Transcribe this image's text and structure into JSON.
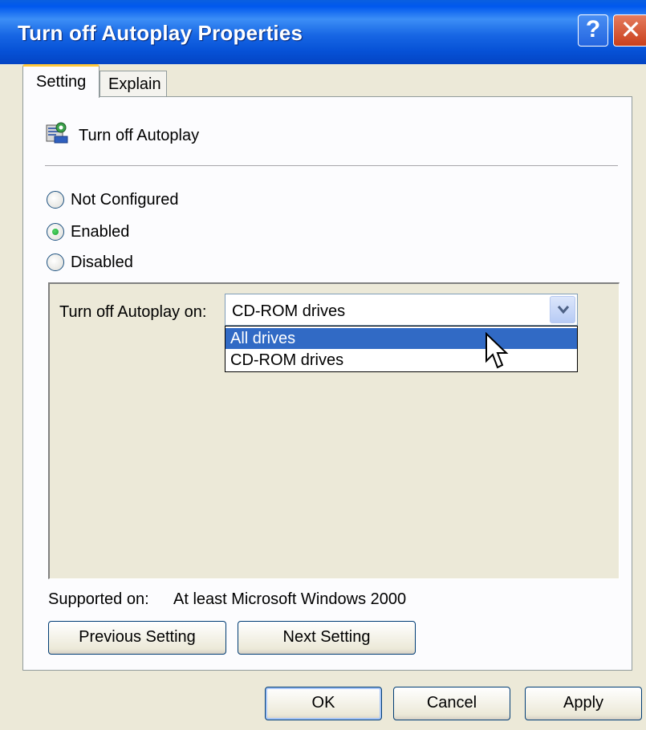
{
  "window": {
    "title": "Turn off Autoplay Properties",
    "help_glyph": "?",
    "close_glyph": "✕"
  },
  "tabs": [
    {
      "label": "Setting",
      "active": true
    },
    {
      "label": "Explain",
      "active": false
    }
  ],
  "policy": {
    "name": "Turn off Autoplay",
    "icon": "policy-setting-icon"
  },
  "radios": [
    {
      "label": "Not Configured",
      "checked": false
    },
    {
      "label": "Enabled",
      "checked": true
    },
    {
      "label": "Disabled",
      "checked": false
    }
  ],
  "options": {
    "label": "Turn off Autoplay on:",
    "combo_value": "CD-ROM drives",
    "dropdown_items": [
      {
        "label": "All drives",
        "highlighted": true
      },
      {
        "label": "CD-ROM drives",
        "highlighted": false
      }
    ]
  },
  "supported": {
    "label": "Supported on:",
    "value": "At least Microsoft Windows 2000"
  },
  "buttons": {
    "previous": "Previous Setting",
    "next": "Next Setting",
    "ok": "OK",
    "cancel": "Cancel",
    "apply": "Apply"
  },
  "colors": {
    "titlebar": "#0058ee",
    "highlight": "#316ac5",
    "face": "#ece9d8"
  }
}
